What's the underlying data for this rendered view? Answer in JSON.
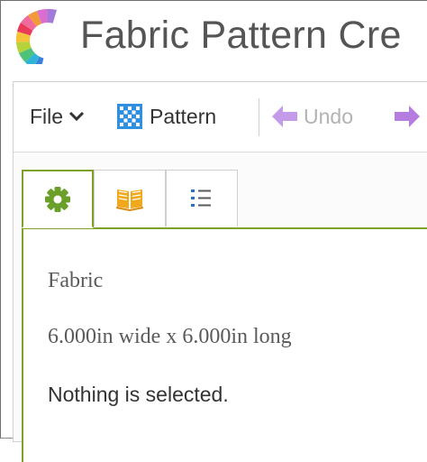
{
  "window": {
    "title": "Fabric Pattern Cre"
  },
  "toolbar": {
    "file_label": "File",
    "pattern_label": "Pattern",
    "undo_label": "Undo",
    "redo_icon": "arrow-right-icon"
  },
  "tabs": [
    {
      "icon": "gear-icon",
      "active": true
    },
    {
      "icon": "book-icon",
      "active": false
    },
    {
      "icon": "list-icon",
      "active": false
    }
  ],
  "content": {
    "heading": "Fabric",
    "dimensions": "6.000in wide x 6.000in long",
    "selection_status": "Nothing is selected."
  },
  "colors": {
    "accent_green": "#7ea12a",
    "gear_green": "#6aa02a",
    "book_orange": "#f0a81c",
    "undo_purple": "#c39be8",
    "redo_purple": "#b57de0",
    "pattern_blue": "#2f8fe0"
  }
}
